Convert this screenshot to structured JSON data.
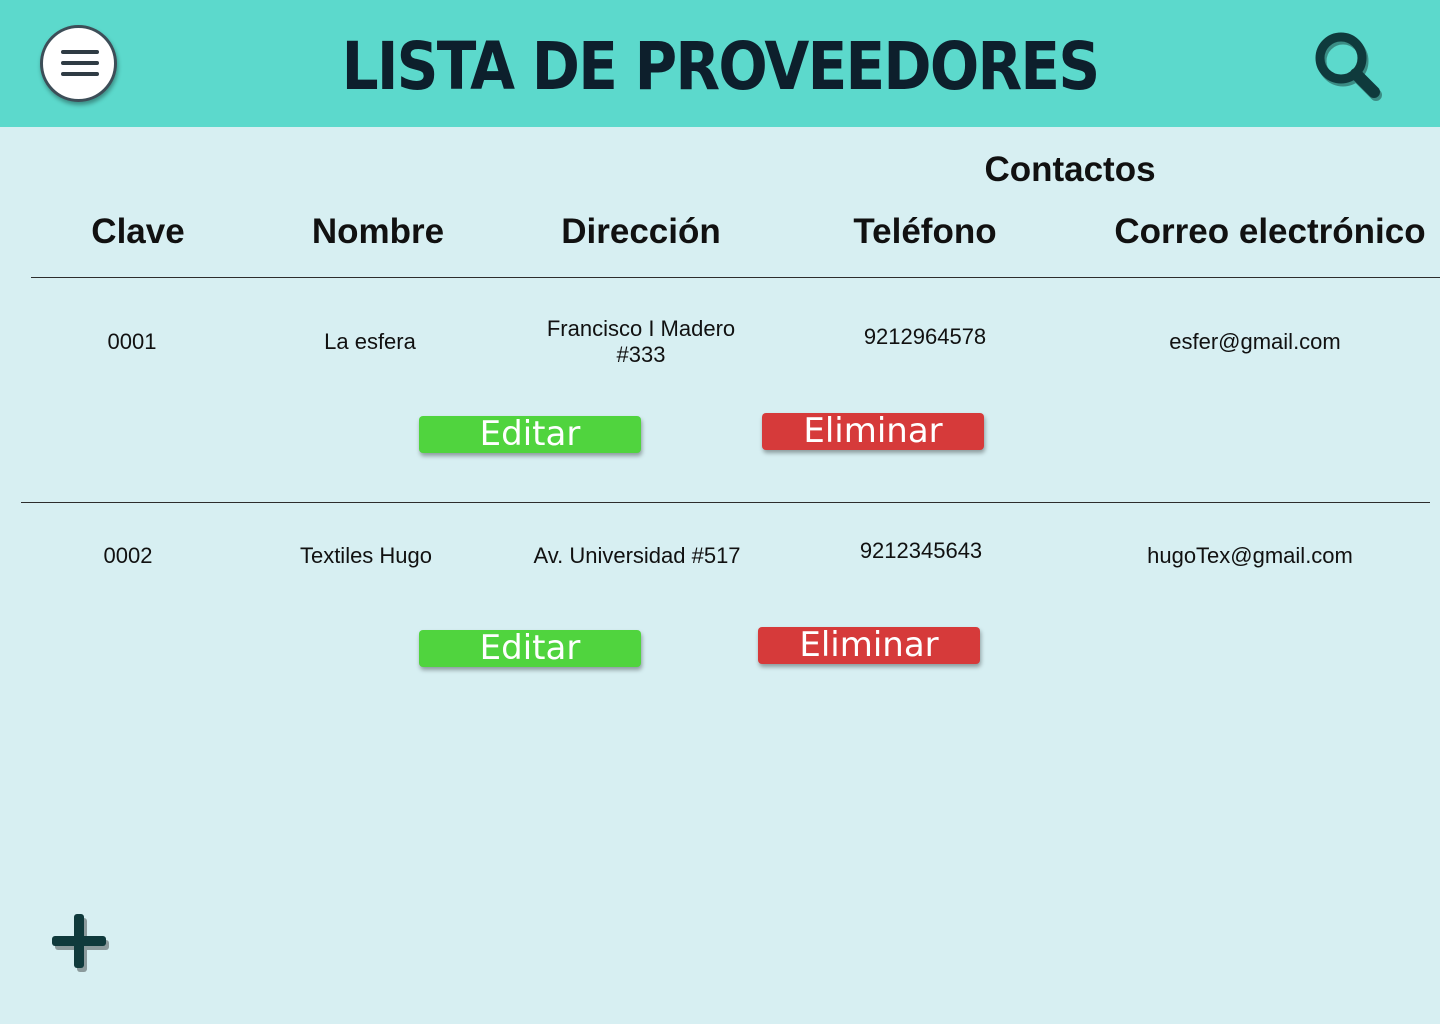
{
  "header": {
    "title": "LISTA DE PROVEEDORES",
    "menu_icon": "hamburger-menu-icon",
    "search_icon": "search-icon",
    "background_color": "#5cd9cc"
  },
  "table": {
    "group_header": "Contactos",
    "columns": {
      "clave": "Clave",
      "nombre": "Nombre",
      "direccion": "Dirección",
      "telefono": "Teléfono",
      "correo": "Correo electrónico"
    },
    "rows": [
      {
        "clave": "0001",
        "nombre": "La esfera",
        "direccion": "Francisco I Madero #333",
        "telefono": "9212964578",
        "correo": "esfer@gmail.com",
        "edit_label": "Editar",
        "delete_label": "Eliminar"
      },
      {
        "clave": "0002",
        "nombre": "Textiles Hugo",
        "direccion": "Av. Universidad #517",
        "telefono": "9212345643",
        "correo": "hugoTex@gmail.com",
        "edit_label": "Editar",
        "delete_label": "Eliminar"
      }
    ]
  },
  "add_icon": "plus-icon",
  "colors": {
    "edit_button": "#50d43e",
    "delete_button": "#d63a3a",
    "page_background": "#d7eff2"
  }
}
